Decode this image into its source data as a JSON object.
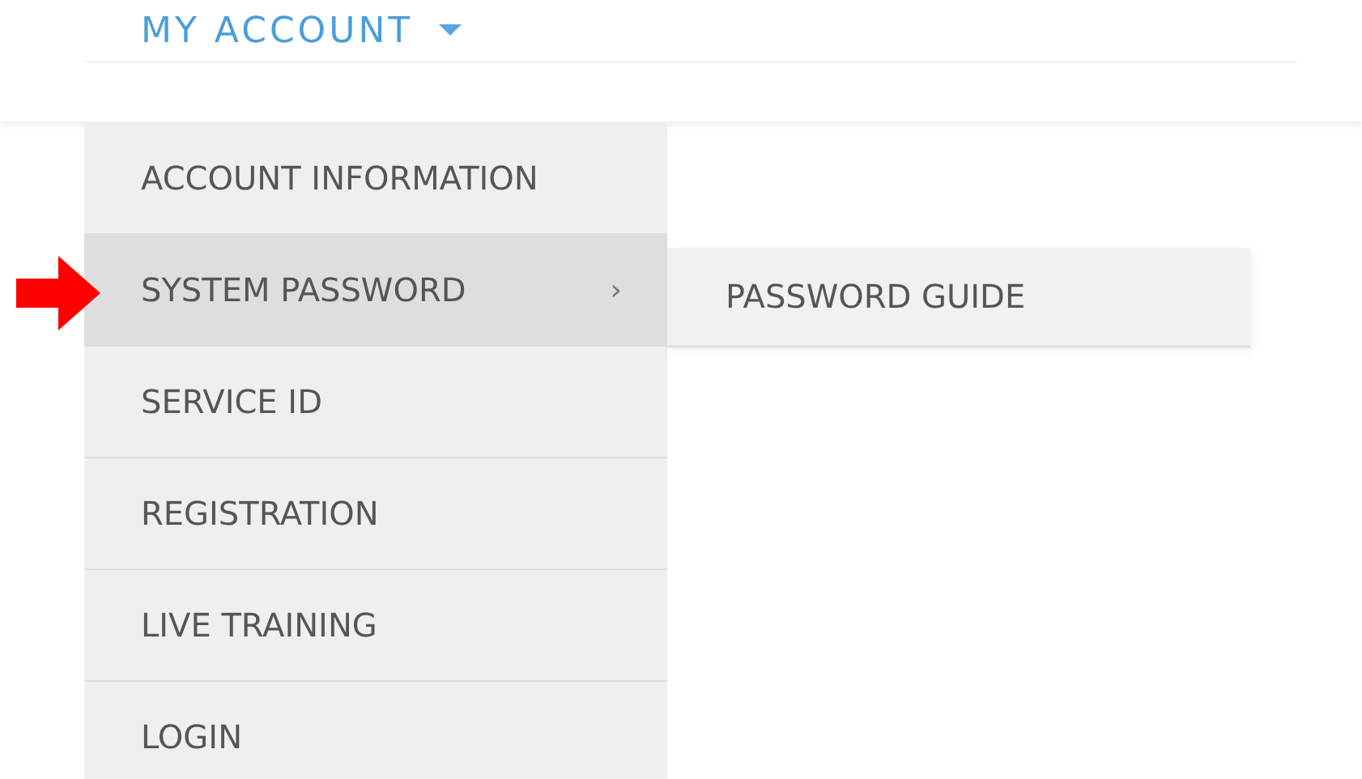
{
  "nav": {
    "label": "MY ACCOUNT"
  },
  "menu": {
    "items": [
      {
        "label": "ACCOUNT INFORMATION",
        "selected": false
      },
      {
        "label": "SYSTEM PASSWORD",
        "selected": true,
        "submenu_mark": "›",
        "pointer": true
      },
      {
        "label": "SERVICE ID",
        "selected": false
      },
      {
        "label": "REGISTRATION",
        "selected": false
      },
      {
        "label": "LIVE TRAINING",
        "selected": false
      },
      {
        "label": "LOGIN",
        "selected": false
      }
    ]
  },
  "submenu": {
    "items": [
      {
        "label": "PASSWORD GUIDE",
        "selected": false
      }
    ]
  }
}
